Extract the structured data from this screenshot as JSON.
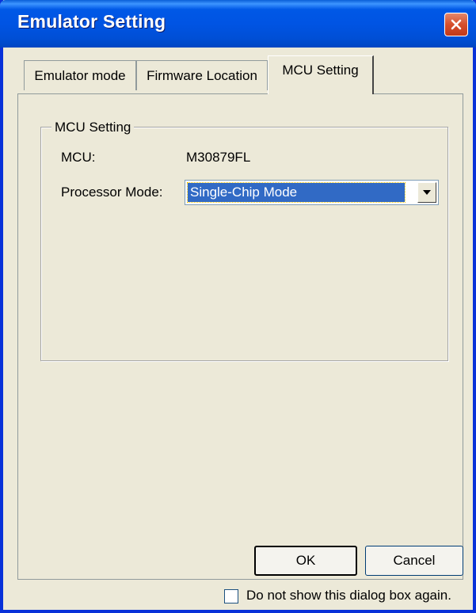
{
  "window": {
    "title": "Emulator Setting"
  },
  "tabs": [
    {
      "label": "Emulator mode",
      "active": false
    },
    {
      "label": "Firmware Location",
      "active": false
    },
    {
      "label": "MCU Setting",
      "active": true
    }
  ],
  "mcu_setting": {
    "group_title": "MCU Setting",
    "mcu_label": "MCU:",
    "mcu_value": "M30879FL",
    "processor_mode_label": "Processor Mode:",
    "processor_mode_value": "Single-Chip Mode"
  },
  "buttons": {
    "ok": "OK",
    "cancel": "Cancel"
  },
  "footer": {
    "checkbox_label": "Do not show this dialog box again.",
    "checked": false
  },
  "icons": {
    "close": "close-icon",
    "dropdown": "chevron-down-icon"
  },
  "colors": {
    "title_bar": "#0054e3",
    "close_button": "#d64f2b",
    "selection": "#316ac5",
    "dialog_face": "#ece9d8"
  }
}
